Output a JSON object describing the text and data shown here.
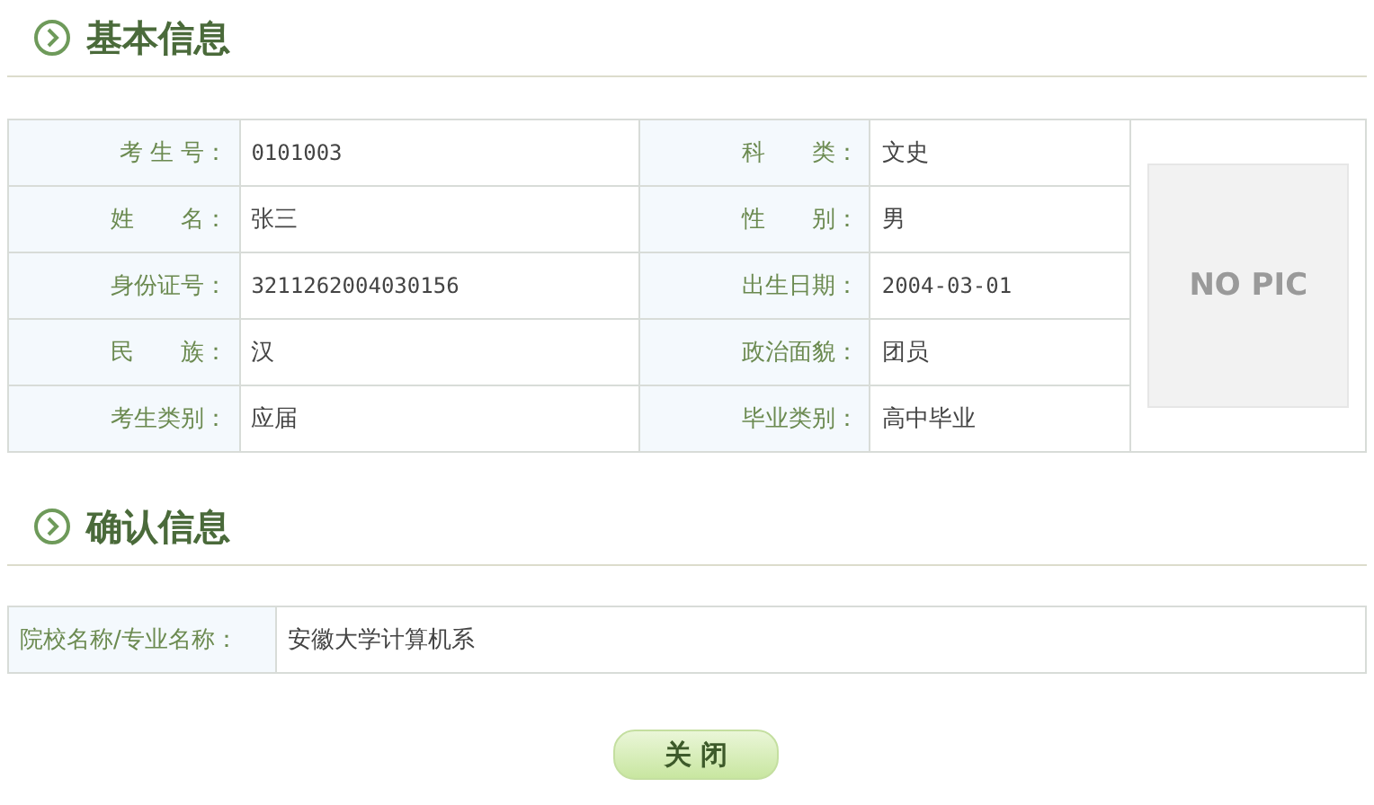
{
  "basic_section": {
    "title": "基本信息"
  },
  "basic_rows": [
    {
      "label_1": "考 生 号：",
      "value_1": "0101003",
      "label_2": "科　　类：",
      "value_2": "文史"
    },
    {
      "label_1": "姓　　名：",
      "value_1": "张三",
      "label_2": "性　　别：",
      "value_2": "男"
    },
    {
      "label_1": "身份证号：",
      "value_1": "3211262004030156",
      "label_2": "出生日期：",
      "value_2": "2004-03-01"
    },
    {
      "label_1": "民　　族：",
      "value_1": "汉",
      "label_2": "政治面貌：",
      "value_2": "团员"
    },
    {
      "label_1": "考生类别：",
      "value_1": "应届",
      "label_2": "毕业类别：",
      "value_2": "高中毕业"
    }
  ],
  "photo": {
    "placeholder_text": "NO PIC"
  },
  "confirm_section": {
    "title": "确认信息"
  },
  "confirm_row": {
    "label": "院校名称/专业名称：",
    "value": "安徽大学计算机系"
  },
  "close_button": {
    "label": "关 闭"
  }
}
